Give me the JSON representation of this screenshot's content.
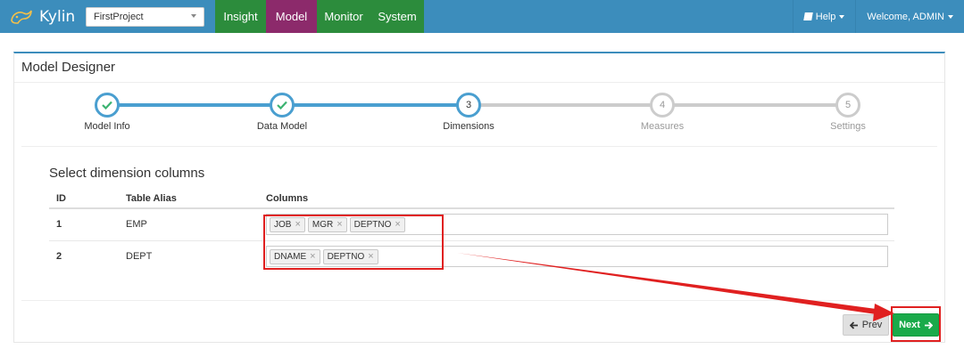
{
  "brand": {
    "name": "Kylin"
  },
  "project_select": {
    "value": "FirstProject"
  },
  "nav_tabs": [
    {
      "label": "Insight",
      "active": false
    },
    {
      "label": "Model",
      "active": true
    },
    {
      "label": "Monitor",
      "active": false
    },
    {
      "label": "System",
      "active": false
    }
  ],
  "nav_right": {
    "help": "Help",
    "user": "Welcome, ADMIN"
  },
  "panel": {
    "title": "Model Designer"
  },
  "wizard": {
    "steps": [
      {
        "number": "",
        "label": "Model Info",
        "state": "done"
      },
      {
        "number": "",
        "label": "Data Model",
        "state": "done"
      },
      {
        "number": "3",
        "label": "Dimensions",
        "state": "current"
      },
      {
        "number": "4",
        "label": "Measures",
        "state": "pending"
      },
      {
        "number": "5",
        "label": "Settings",
        "state": "pending"
      }
    ]
  },
  "section": {
    "title": "Select dimension columns"
  },
  "table": {
    "headers": {
      "id": "ID",
      "alias": "Table Alias",
      "columns": "Columns"
    },
    "rows": [
      {
        "id": "1",
        "alias": "EMP",
        "columns": [
          "JOB",
          "MGR",
          "DEPTNO"
        ]
      },
      {
        "id": "2",
        "alias": "DEPT",
        "columns": [
          "DNAME",
          "DEPTNO"
        ]
      }
    ]
  },
  "buttons": {
    "prev": "Prev",
    "next": "Next"
  },
  "colors": {
    "navbar": "#3c8dbc",
    "tab": "#2c8c3c",
    "active_tab": "#8c2a6b",
    "next_button": "#1aaa4a",
    "annotation": "#e02020",
    "step_done": "#4a9fd0"
  },
  "icons": {
    "done": "check-icon",
    "prev": "arrow-left-icon",
    "next": "arrow-right-icon",
    "help": "book-icon",
    "dropdown": "caret-down-icon"
  }
}
